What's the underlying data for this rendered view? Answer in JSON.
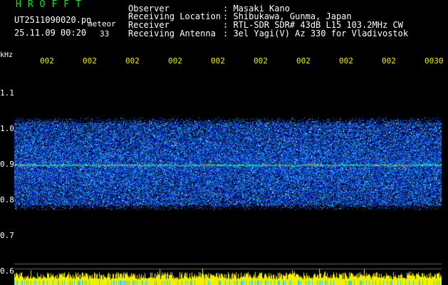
{
  "header": {
    "app_title": "HROFFT",
    "file_name": "UT2511090020.pn",
    "file_tag": "meteor",
    "date_time": "25.11.09 00:20",
    "count": "33",
    "observer_key": "Observer",
    "observer_value": ": Masaki Kano",
    "location_key": "Receiving Location",
    "location_value": ": Shibukawa, Gunma, Japan",
    "receiver_key": "Receiver",
    "receiver_value": ": RTL-SDR SDR# 43dB L15 103.2MHz CW",
    "antenna_key": "Receiving Antenna",
    "antenna_value": ": 3el Yagi(V) Az 330 for Vladivostok"
  },
  "axis": {
    "unit": "kHz",
    "time_labels": [
      "002",
      "002",
      "002",
      "002",
      "002",
      "002",
      "002",
      "002",
      "002",
      "0030"
    ],
    "freq_labels": [
      "1.1",
      "1.0",
      "0.9",
      "0.8",
      "0.7",
      "0.6"
    ]
  },
  "colors": {
    "background": "#000000",
    "title_green": "#19e619",
    "time_label_yellow": "#f0f000",
    "noise_blue": "#1030c0",
    "echo_line": "#00c8a0",
    "power_bar_yellow": "#f0f000"
  },
  "chart_data": {
    "type": "heatmap",
    "x_labels": [
      "002",
      "002",
      "002",
      "002",
      "002",
      "002",
      "002",
      "002",
      "002",
      "0030"
    ],
    "y_labels": [
      "1.1",
      "1.0",
      "0.9",
      "0.8",
      "0.7",
      "0.6"
    ],
    "ylabel": "kHz",
    "noise_band_khz": [
      0.79,
      1.02
    ],
    "carrier_khz": 0.9
  }
}
